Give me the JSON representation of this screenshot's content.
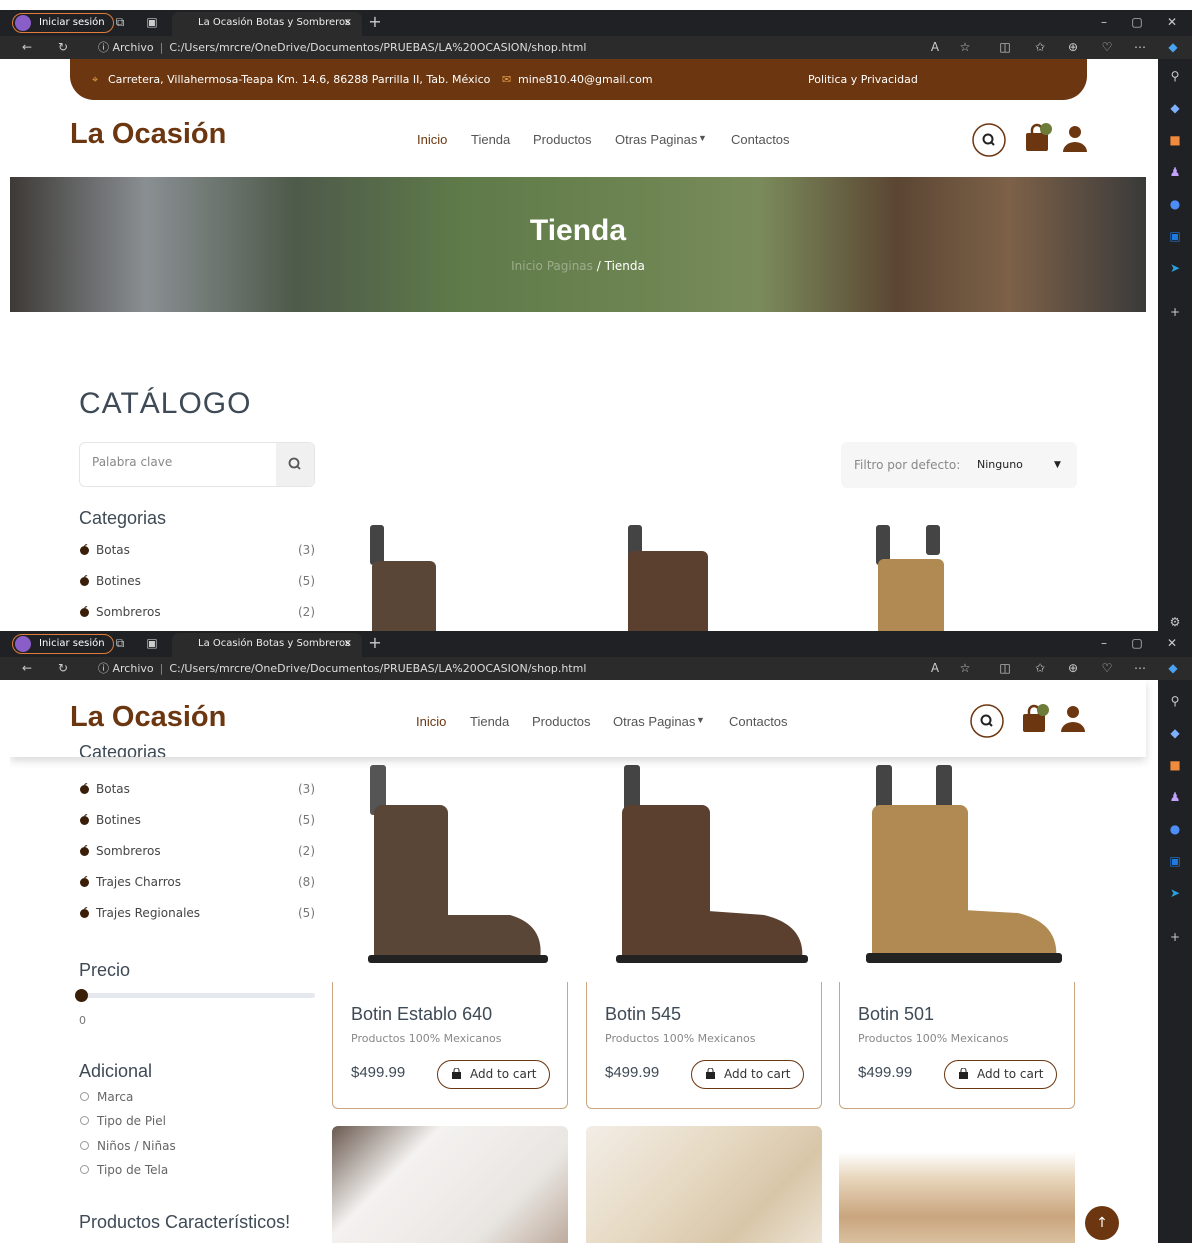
{
  "browser": {
    "profile_label": "Iniciar sesión",
    "tab_title": "La Ocasión Botas y Sombreros",
    "addr_scheme": "Archivo",
    "addr_path": "C:/Users/mrcre/OneDrive/Documentos/PRUEBAS/LA%20OCASION/shop.html",
    "new_tab": "+",
    "tab_close": "×"
  },
  "topbar": {
    "address": "Carretera, Villahermosa-Teapa Km. 14.6, 86288 Parrilla II, Tab. México",
    "email": "mine810.40@gmail.com",
    "policy": "Politica y Privacidad"
  },
  "header": {
    "logo": "La Ocasión",
    "nav": [
      "Inicio",
      "Tienda",
      "Productos",
      "Otras Paginas",
      "Contactos"
    ]
  },
  "hero": {
    "title": "Tienda",
    "crumb_home": "Inicio",
    "crumb_mid": "Paginas",
    "crumb_current": "/ Tienda"
  },
  "catalog": {
    "heading": "CATÁLOGO",
    "search_placeholder": "Palabra clave",
    "filter_label": "Filtro por defecto:",
    "filter_value": "Ninguno"
  },
  "sidebar": {
    "categories_title": "Categorias",
    "categories": [
      {
        "name": "Botas",
        "count": "(3)"
      },
      {
        "name": "Botines",
        "count": "(5)"
      },
      {
        "name": "Sombreros",
        "count": "(2)"
      },
      {
        "name": "Trajes Charros",
        "count": "(8)"
      },
      {
        "name": "Trajes Regionales",
        "count": "(5)"
      }
    ],
    "price_title": "Precio",
    "price_value": "0",
    "price_fraction": 0,
    "additional_title": "Adicional",
    "additional": [
      "Marca",
      "Tipo de Piel",
      "Niños / Niñas",
      "Tipo de Tela"
    ],
    "featured_title": "Productos Característicos!"
  },
  "products": [
    {
      "name": "Botin Establo 640",
      "desc": "Productos 100% Mexicanos",
      "price": "$499.99",
      "cart": "Add to cart",
      "color": "#5a4636"
    },
    {
      "name": "Botin 545",
      "desc": "Productos 100% Mexicanos",
      "price": "$499.99",
      "cart": "Add to cart",
      "color": "#5b4030"
    },
    {
      "name": "Botin 501",
      "desc": "Productos 100% Mexicanos",
      "price": "$499.99",
      "cart": "Add to cart",
      "color": "#b08a52"
    }
  ],
  "colors": {
    "brand": "#6b3610",
    "text": "#3e4a56"
  }
}
